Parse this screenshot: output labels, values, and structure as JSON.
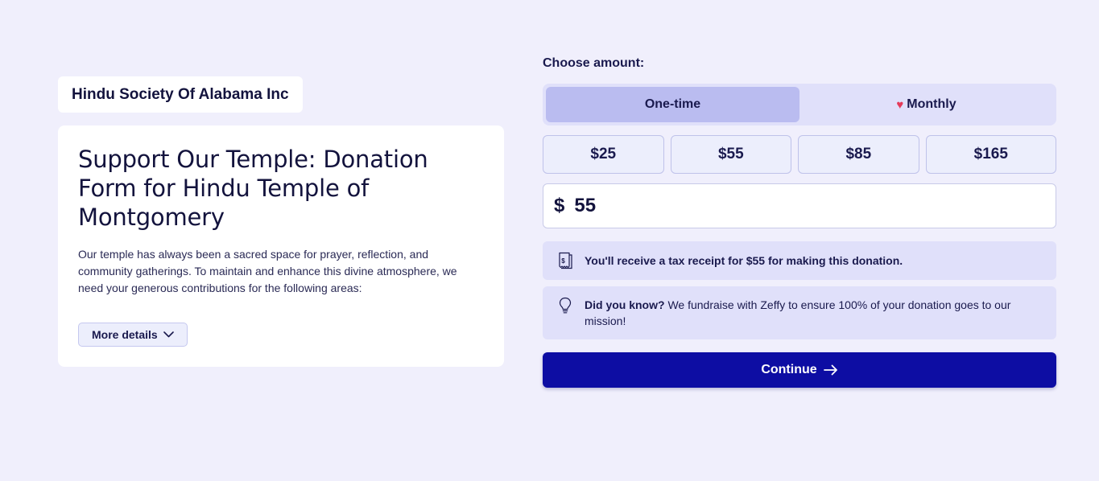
{
  "organization": {
    "name": "Hindu Society Of Alabama Inc"
  },
  "campaign": {
    "title": "Support Our Temple: Donation Form for Hindu Temple of Montgomery",
    "description": "Our temple has always been a sacred space for prayer, reflection, and community gatherings. To maintain and enhance this divine atmosphere, we need your generous contributions for the following areas:",
    "more_details_label": "More details"
  },
  "donation": {
    "choose_label": "Choose amount:",
    "frequency": {
      "options": [
        "One-time",
        "Monthly"
      ],
      "selected": "One-time"
    },
    "amounts": [
      "$25",
      "$55",
      "$85",
      "$165"
    ],
    "currency_symbol": "$",
    "amount_value": "55",
    "receipt_notice": "You'll receive a tax receipt for $55 for making this donation.",
    "tip": {
      "lead": "Did you know?",
      "body": " We fundraise with Zeffy to ensure 100% of your donation goes to our mission!"
    },
    "continue_label": "Continue"
  },
  "colors": {
    "background": "#f0effc",
    "accent": "#0d0da3",
    "toggle_active": "#babcf0",
    "heart": "#e53b5a"
  },
  "icons": {
    "monthly": "heart-icon",
    "receipt": "receipt-icon",
    "tip": "lightbulb-icon",
    "more_details": "chevron-down-icon",
    "continue": "arrow-right-icon"
  }
}
